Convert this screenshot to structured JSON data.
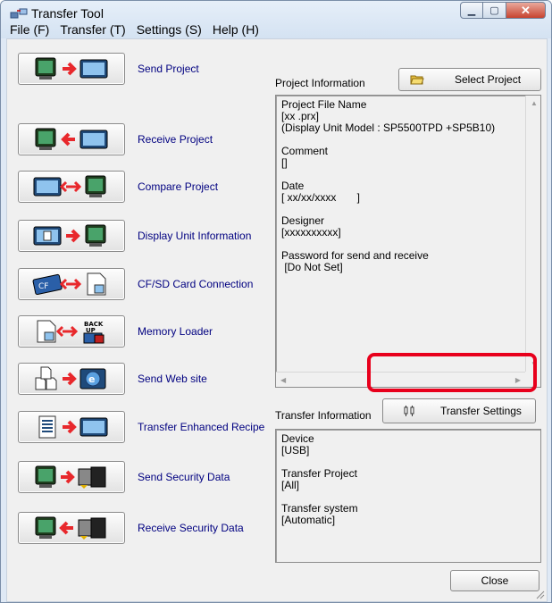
{
  "window": {
    "title": "Transfer Tool"
  },
  "menu": [
    "File (F)",
    "Transfer (T)",
    "Settings (S)",
    "Help (H)"
  ],
  "commands": [
    {
      "label": "Send Project",
      "icon": "pc-arrow-right-display-icon"
    },
    {
      "label": "Receive Project",
      "icon": "pc-arrow-left-display-icon"
    },
    {
      "label": "Compare Project",
      "icon": "display-compare-pc-icon"
    },
    {
      "label": "Display Unit Information",
      "icon": "display-info-to-pc-icon"
    },
    {
      "label": "CF/SD Card Connection",
      "icon": "cf-card-file-icon"
    },
    {
      "label": "Memory Loader",
      "icon": "file-backup-icon"
    },
    {
      "label": "Send Web site",
      "icon": "web-files-to-ie-icon"
    },
    {
      "label": "Transfer Enhanced Recipe",
      "icon": "recipe-to-display-icon"
    },
    {
      "label": "Send Security Data",
      "icon": "pc-to-security-device-icon"
    },
    {
      "label": "Receive Security Data",
      "icon": "security-device-to-pc-icon"
    }
  ],
  "project": {
    "group_label": "Project Information",
    "select_button": "Select Project",
    "lines": [
      "Project File Name",
      "[xx .prx]",
      "(Display Unit Model : SP5500TPD +SP5B10)",
      "",
      "Comment",
      "[]",
      "",
      "Date",
      "[ xx/xx/xxxx       ]",
      "",
      "Designer",
      "[xxxxxxxxxx]",
      "",
      "Password for send and receive",
      " [Do Not Set]"
    ]
  },
  "transfer": {
    "group_label": "Transfer Information",
    "settings_button": "Transfer Settings",
    "lines": [
      "Device",
      "[USB]",
      "",
      "Transfer Project",
      "[All]",
      "",
      "Transfer system",
      "[Automatic]"
    ]
  },
  "close_button": "Close",
  "colors": {
    "highlight": "#e8001c",
    "link_text": "#000080",
    "arrow": "#e8282c"
  }
}
